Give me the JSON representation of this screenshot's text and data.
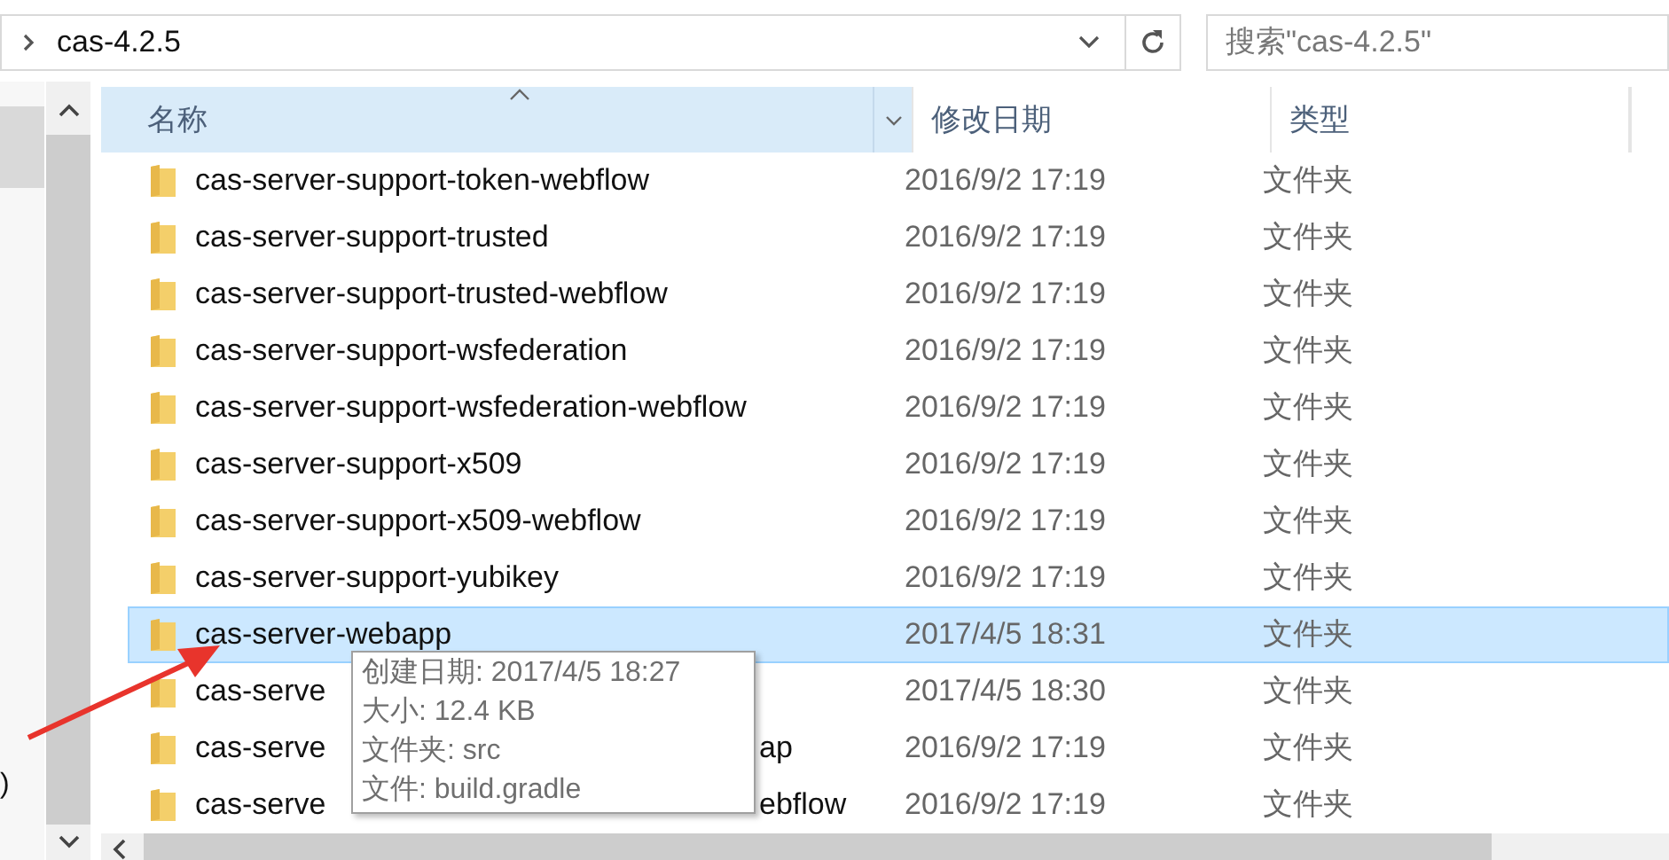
{
  "address_bar": {
    "path": "cas-4.2.5"
  },
  "search": {
    "placeholder": "搜索\"cas-4.2.5\""
  },
  "nav_pane": {
    "clipped_text": ")"
  },
  "columns": [
    {
      "label": "名称",
      "selected": true
    },
    {
      "label": "修改日期",
      "selected": false
    },
    {
      "label": "类型",
      "selected": false
    }
  ],
  "rows": [
    {
      "name": "cas-server-support-token-webflow",
      "modified": "2016/9/2 17:19",
      "type": "文件夹",
      "selected": false
    },
    {
      "name": "cas-server-support-trusted",
      "modified": "2016/9/2 17:19",
      "type": "文件夹",
      "selected": false
    },
    {
      "name": "cas-server-support-trusted-webflow",
      "modified": "2016/9/2 17:19",
      "type": "文件夹",
      "selected": false
    },
    {
      "name": "cas-server-support-wsfederation",
      "modified": "2016/9/2 17:19",
      "type": "文件夹",
      "selected": false
    },
    {
      "name": "cas-server-support-wsfederation-webflow",
      "modified": "2016/9/2 17:19",
      "type": "文件夹",
      "selected": false
    },
    {
      "name": "cas-server-support-x509",
      "modified": "2016/9/2 17:19",
      "type": "文件夹",
      "selected": false
    },
    {
      "name": "cas-server-support-x509-webflow",
      "modified": "2016/9/2 17:19",
      "type": "文件夹",
      "selected": false
    },
    {
      "name": "cas-server-support-yubikey",
      "modified": "2016/9/2 17:19",
      "type": "文件夹",
      "selected": false
    },
    {
      "name": "cas-server-webapp",
      "modified": "2017/4/5 18:31",
      "type": "文件夹",
      "selected": true
    },
    {
      "name": "cas-serve",
      "modified": "2017/4/5 18:30",
      "type": "文件夹",
      "selected": false
    },
    {
      "name": "cas-serve",
      "name_end": "ap",
      "modified": "2016/9/2 17:19",
      "type": "文件夹",
      "selected": false
    },
    {
      "name": "cas-serve",
      "name_end": "ebflow",
      "modified": "2016/9/2 17:19",
      "type": "文件夹",
      "selected": false
    }
  ],
  "tooltip": {
    "lines": [
      "创建日期: 2017/4/5 18:27",
      "大小: 12.4 KB",
      "文件夹: src",
      "文件: build.gradle"
    ]
  }
}
